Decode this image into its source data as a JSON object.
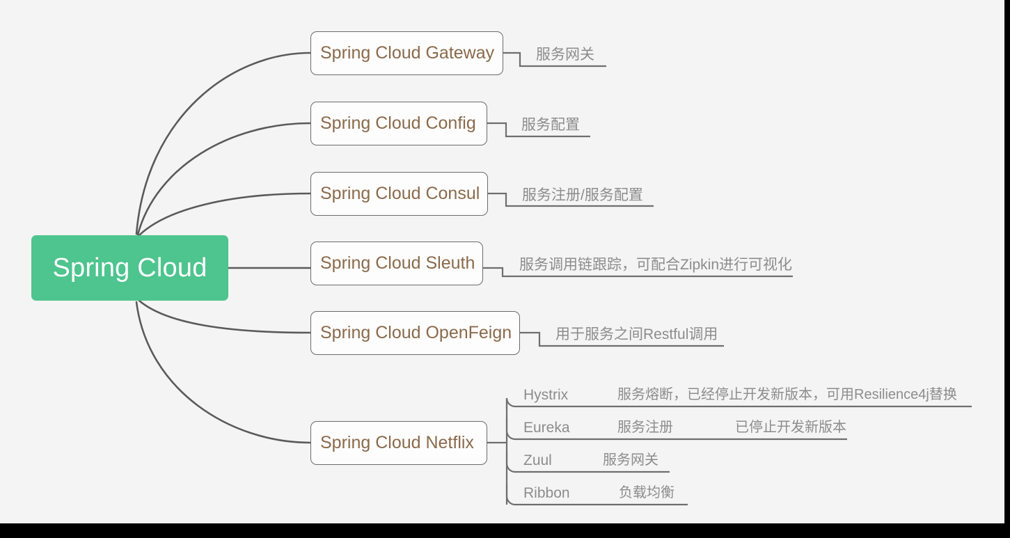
{
  "diagram": {
    "type": "mindmap",
    "background_color": "#f4f4f4",
    "root": {
      "label": "Spring Cloud",
      "fill_color": "#4ec48e",
      "text_color": "#ffffff"
    },
    "node_text_color": "#8a6a4b",
    "annotation_text_color": "#8c8c8c",
    "connector_color": "#5a5a5a",
    "branches": [
      {
        "id": "gateway",
        "label": "Spring Cloud Gateway",
        "annotation": "服务网关"
      },
      {
        "id": "config",
        "label": "Spring Cloud Config",
        "annotation": "服务配置"
      },
      {
        "id": "consul",
        "label": "Spring Cloud Consul",
        "annotation": "服务注册/服务配置"
      },
      {
        "id": "sleuth",
        "label": "Spring Cloud Sleuth",
        "annotation": "服务调用链跟踪，可配合Zipkin进行可视化"
      },
      {
        "id": "openfeign",
        "label": "Spring Cloud OpenFeign",
        "annotation": "用于服务之间Restful调用"
      },
      {
        "id": "netflix",
        "label": "Spring Cloud Netflix",
        "annotation": "",
        "children": [
          {
            "id": "hystrix",
            "name": "Hystrix",
            "desc": "服务熔断，已经停止开发新版本，可用Resilience4j替换",
            "note": ""
          },
          {
            "id": "eureka",
            "name": "Eureka",
            "desc": "服务注册",
            "note": "已停止开发新版本"
          },
          {
            "id": "zuul",
            "name": "Zuul",
            "desc": "服务网关",
            "note": ""
          },
          {
            "id": "ribbon",
            "name": "Ribbon",
            "desc": "负载均衡",
            "note": ""
          }
        ]
      }
    ]
  }
}
